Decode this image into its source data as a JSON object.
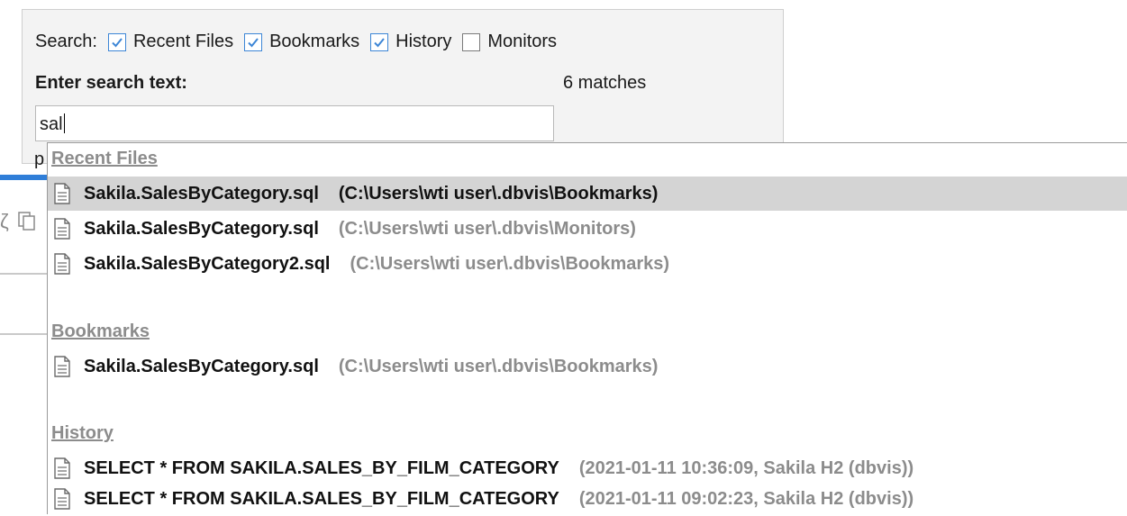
{
  "search_panel": {
    "search_label": "Search:",
    "options": [
      {
        "label": "Recent Files",
        "checked": true
      },
      {
        "label": "Bookmarks",
        "checked": true
      },
      {
        "label": "History",
        "checked": true
      },
      {
        "label": "Monitors",
        "checked": false
      }
    ],
    "enter_label": "Enter search text:",
    "match_count": "6 matches",
    "search_value": "sal",
    "partial_text": "p"
  },
  "background": {
    "toolbar_glyph": "ζ"
  },
  "results": {
    "recent_files": {
      "title": "Recent Files",
      "items": [
        {
          "name": "Sakila.SalesByCategory.sql",
          "path": "(C:\\Users\\wti user\\.dbvis\\Bookmarks)",
          "selected": true
        },
        {
          "name": "Sakila.SalesByCategory.sql",
          "path": "(C:\\Users\\wti user\\.dbvis\\Monitors)",
          "selected": false
        },
        {
          "name": "Sakila.SalesByCategory2.sql",
          "path": "(C:\\Users\\wti user\\.dbvis\\Bookmarks)",
          "selected": false
        }
      ]
    },
    "bookmarks": {
      "title": "Bookmarks",
      "items": [
        {
          "name": "Sakila.SalesByCategory.sql",
          "path": "(C:\\Users\\wti user\\.dbvis\\Bookmarks)",
          "selected": false
        }
      ]
    },
    "history": {
      "title": "History",
      "items": [
        {
          "name": "SELECT * FROM SAKILA.SALES_BY_FILM_CATEGORY",
          "path": "(2021-01-11 10:36:09,  Sakila H2 (dbvis))",
          "selected": false
        },
        {
          "name": "SELECT * FROM SAKILA.SALES_BY_FILM_CATEGORY",
          "path": "(2021-01-11 09:02:23,  Sakila H2 (dbvis))",
          "selected": false
        }
      ]
    }
  },
  "colors": {
    "accent_blue": "#2f7ed8",
    "selection": "#d4d4d4",
    "muted_text": "#8c8c8c"
  }
}
